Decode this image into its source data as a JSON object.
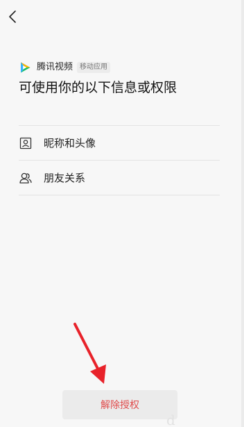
{
  "header": {
    "back_icon": "chevron-left-icon"
  },
  "app": {
    "name": "腾讯视频",
    "tag": "移动应用",
    "logo_icon": "tencent-video-logo-icon"
  },
  "page": {
    "title": "可使用你的以下信息或权限"
  },
  "permissions": [
    {
      "label": "昵称和头像",
      "icon": "profile-card-icon"
    },
    {
      "label": "朋友关系",
      "icon": "friends-icon"
    }
  ],
  "actions": {
    "revoke_label": "解除授权"
  },
  "colors": {
    "background": "#f7f7f7",
    "revoke_text": "#e04b4b",
    "annotation_arrow": "#e8222a"
  }
}
